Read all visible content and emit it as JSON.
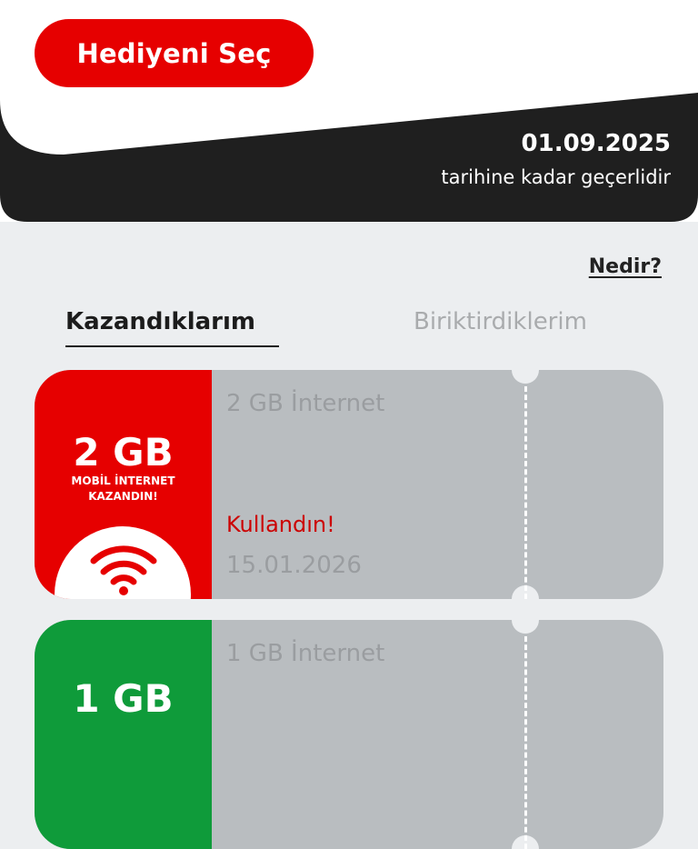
{
  "header": {
    "cta_label": "Hediyeni Seç",
    "valid_date": "01.09.2025",
    "valid_text": "tarihine kadar geçerlidir"
  },
  "info_link": "Nedir?",
  "tabs": [
    {
      "label": "Kazandıklarım",
      "active": true
    },
    {
      "label": "Biriktirdiklerim",
      "active": false
    }
  ],
  "cards": [
    {
      "badge_value": "2 GB",
      "badge_line1": "MOBİL İNTERNET",
      "badge_line2": "KAZANDIN!",
      "badge_color": "#e60000",
      "title": "2 GB İnternet",
      "status": "Kullandın!",
      "date": "15.01.2026",
      "icon": "wifi-icon"
    },
    {
      "badge_value": "1 GB",
      "badge_color": "#0f9b3a",
      "title": "1 GB İnternet"
    }
  ],
  "colors": {
    "brand_red": "#e60000",
    "dark_band": "#1f1f1f",
    "ticket_gray": "#b9bdc0",
    "page_bg": "#eceef0",
    "green": "#0f9b3a"
  }
}
